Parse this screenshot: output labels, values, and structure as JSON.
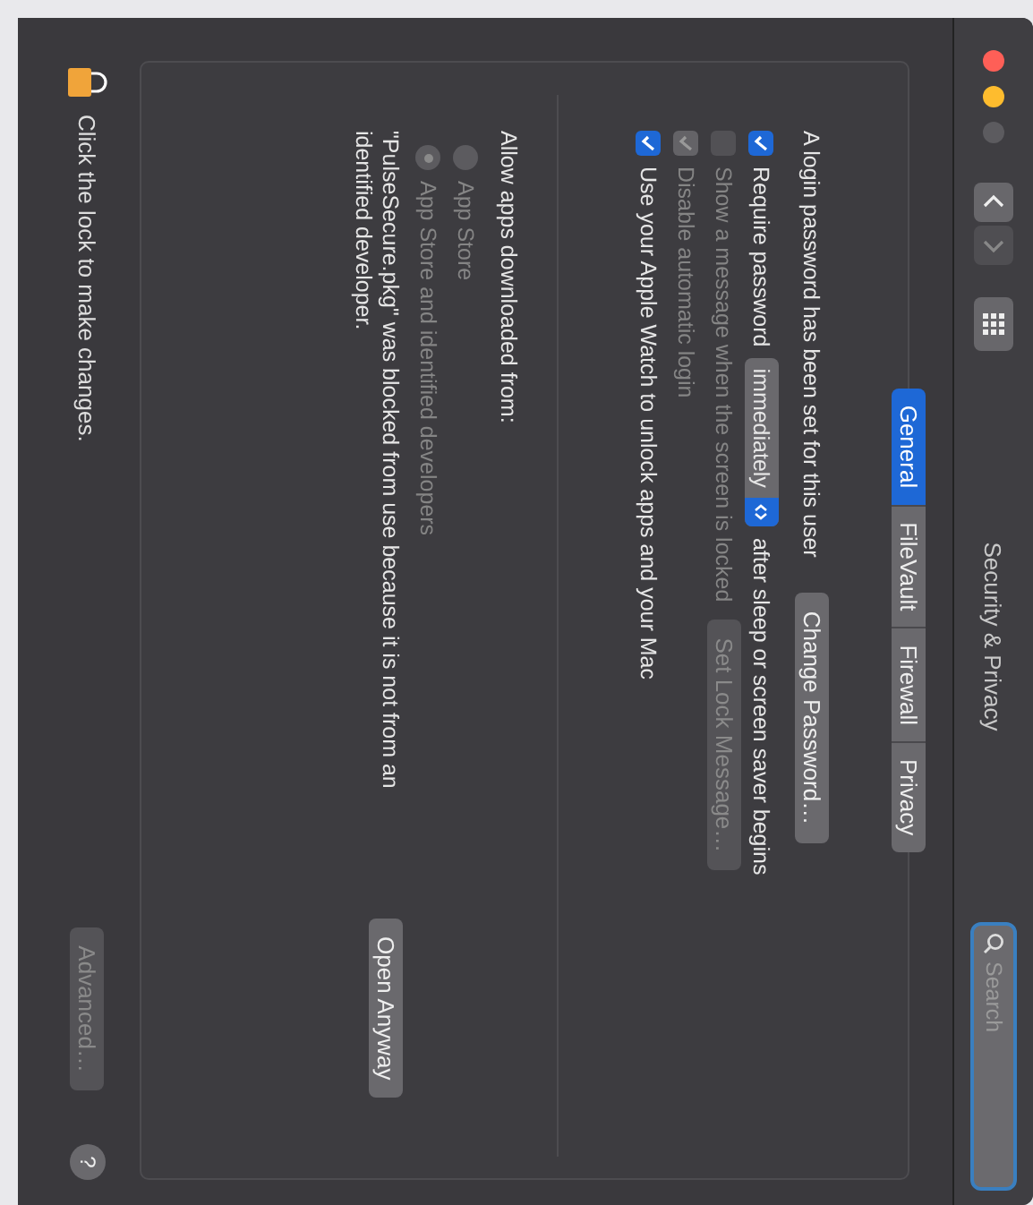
{
  "window": {
    "title": "Security & Privacy"
  },
  "toolbar": {
    "search": {
      "placeholder": "Search"
    }
  },
  "tabs": [
    {
      "label": "General",
      "selected": true
    },
    {
      "label": "FileVault",
      "selected": false
    },
    {
      "label": "Firewall",
      "selected": false
    },
    {
      "label": "Privacy",
      "selected": false
    }
  ],
  "login": {
    "text": "A login password has been set for this user",
    "button": "Change Password…"
  },
  "options": [
    {
      "kind": "popup",
      "label": "Require password",
      "checked": true,
      "disabled": false,
      "popup": "immediately",
      "suffix": "after sleep or screen saver begins"
    },
    {
      "kind": "button",
      "label": "Show a message when the screen is locked",
      "checked": false,
      "disabled": true,
      "button": "Set Lock Message…"
    },
    {
      "kind": "plain",
      "label": "Disable automatic login",
      "checked": true,
      "disabled": true
    },
    {
      "kind": "plain",
      "label": "Use your Apple Watch to unlock apps and your Mac",
      "checked": true,
      "disabled": false
    }
  ],
  "downloads": {
    "heading": "Allow apps downloaded from:",
    "radios": [
      {
        "label": "App Store",
        "selected": false,
        "disabled": true
      },
      {
        "label": "App Store and identified developers",
        "selected": true,
        "disabled": true
      }
    ],
    "blocked_message": "\"PulseSecure.pkg\" was blocked from use because it is not from an identified developer.",
    "open_button": "Open Anyway"
  },
  "footer": {
    "lock_text": "Click the lock to make changes.",
    "advanced_button": "Advanced…",
    "advanced_disabled": true,
    "help": "?"
  }
}
